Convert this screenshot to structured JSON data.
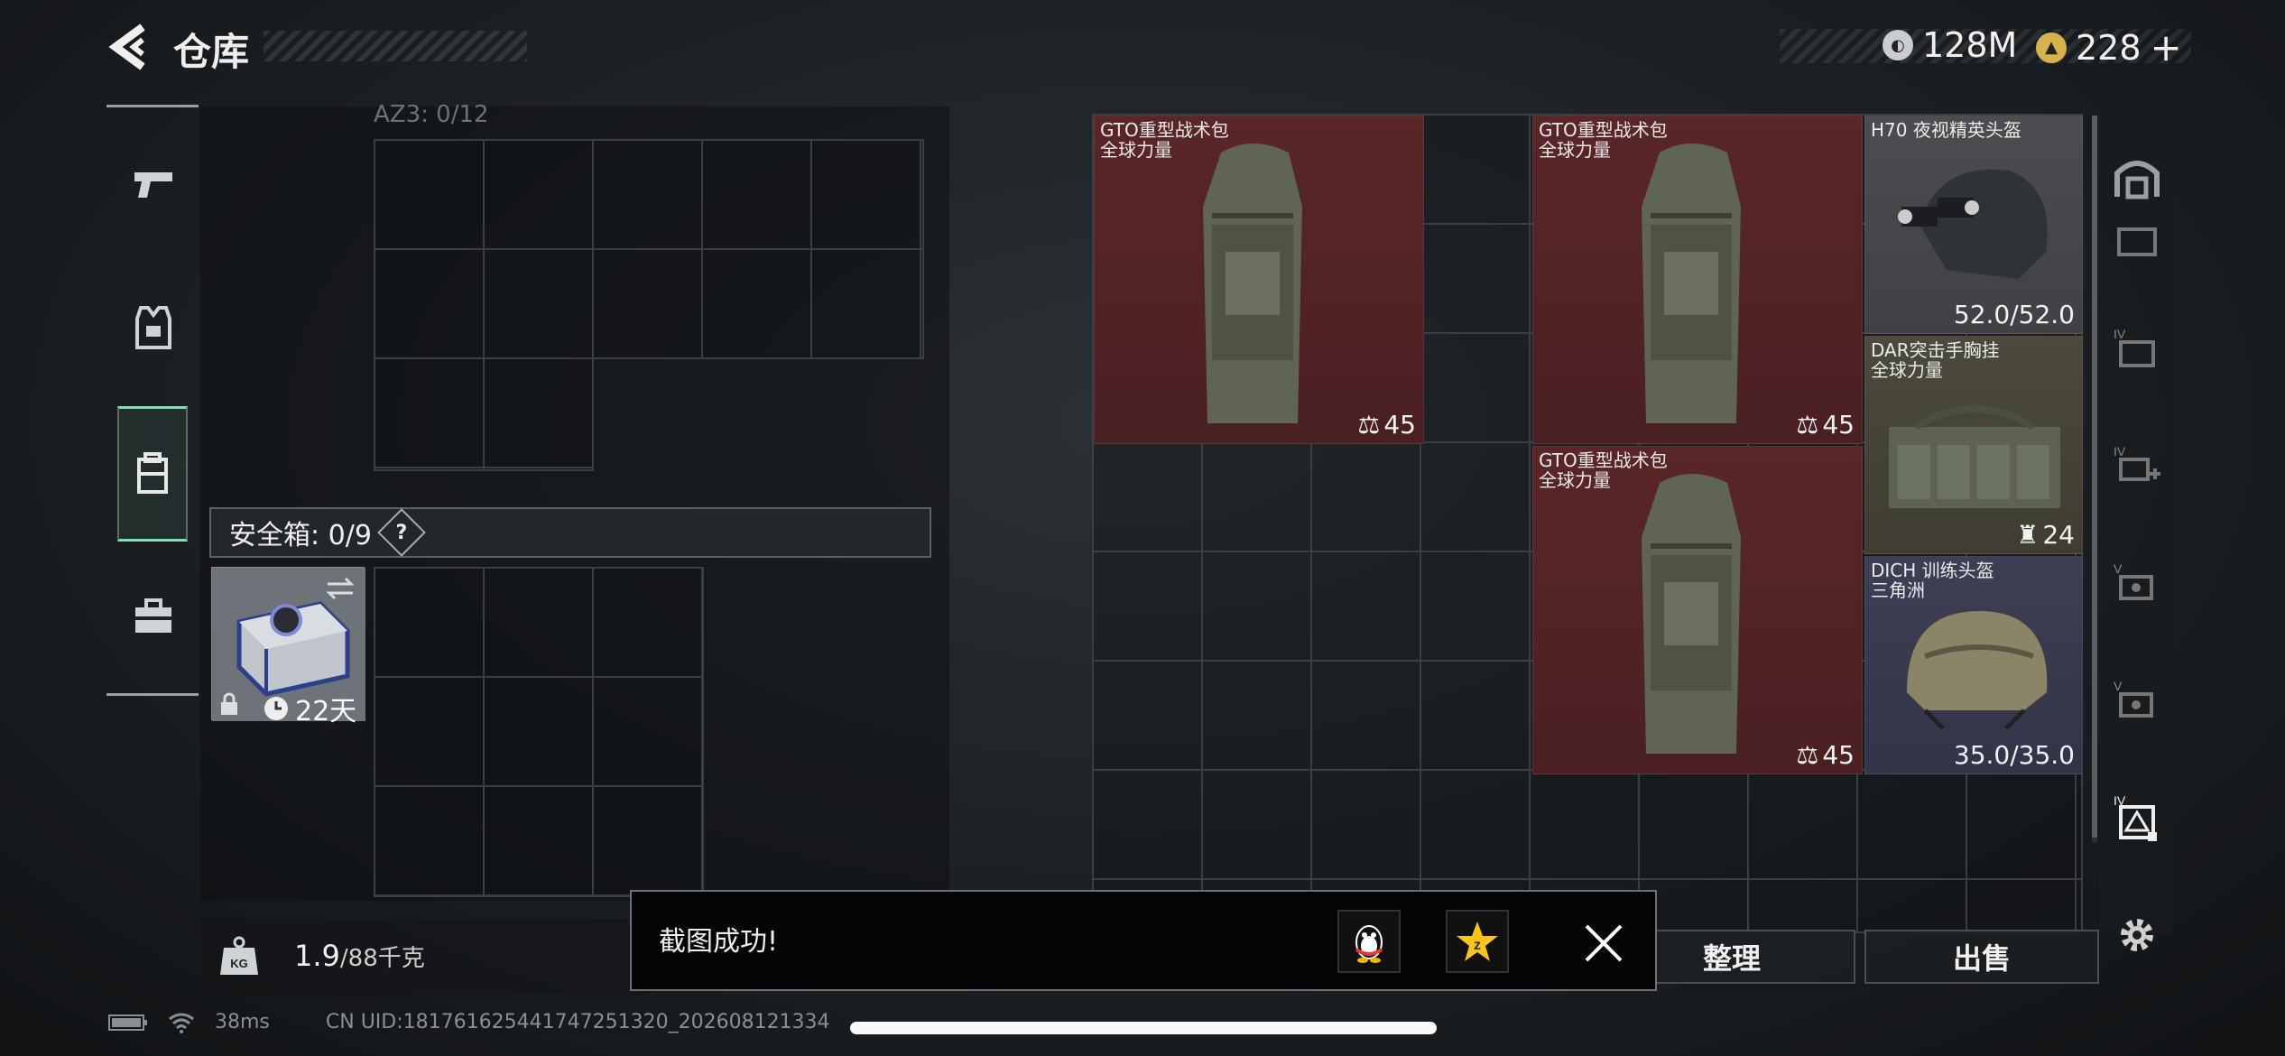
{
  "header": {
    "title": "仓库",
    "back_label": "back"
  },
  "currency": [
    {
      "icon": "silver-coin-icon",
      "value": "128M",
      "color": "#c9cdd2"
    },
    {
      "icon": "gold-coin-icon",
      "value": "228",
      "add_label": "+",
      "color": "#d6b24a"
    }
  ],
  "nav": {
    "items": [
      {
        "name": "weapons",
        "icon": "pistol-icon"
      },
      {
        "name": "armor",
        "icon": "vest-icon"
      },
      {
        "name": "backpack",
        "icon": "backpack-icon",
        "active": true
      },
      {
        "name": "tools",
        "icon": "toolbox-icon"
      }
    ]
  },
  "left_panel": {
    "container_label": "AZ3: 0/12",
    "safe_box_label": "安全箱: 0/9",
    "help_label": "?",
    "safe_item_days": "22天",
    "weight_value": "1.9",
    "weight_capacity": "/88千克",
    "weight_icon_label": "KG"
  },
  "items": [
    {
      "name": "GTO重型战术包",
      "subtitle": "全球力量",
      "badge": "45",
      "color": "red"
    },
    {
      "name": "GTO重型战术包",
      "subtitle": "全球力量",
      "badge": "45",
      "color": "red"
    },
    {
      "name": "H70 夜视精英头盔",
      "subtitle": "",
      "badge": "52.0/52.0",
      "color": "gray"
    },
    {
      "name": "DAR突击手胸挂",
      "subtitle": "全球力量",
      "badge": "24",
      "color": "olive"
    },
    {
      "name": "GTO重型战术包",
      "subtitle": "全球力量",
      "badge": "45",
      "color": "red"
    },
    {
      "name": "DICH 训练头盔",
      "subtitle": "三角洲",
      "badge": "35.0/35.0",
      "color": "navy"
    }
  ],
  "right_sidebar": {
    "labels": [
      "",
      "",
      "IV",
      "IV",
      "V",
      "V",
      "IV"
    ]
  },
  "actions": {
    "sort_label": "整理",
    "sell_label": "出售"
  },
  "toast": {
    "message": "截图成功!",
    "close_label": "×"
  },
  "status": {
    "ping": "38ms",
    "uid": "CN UID:18176162544174725132​0_202608121334"
  }
}
